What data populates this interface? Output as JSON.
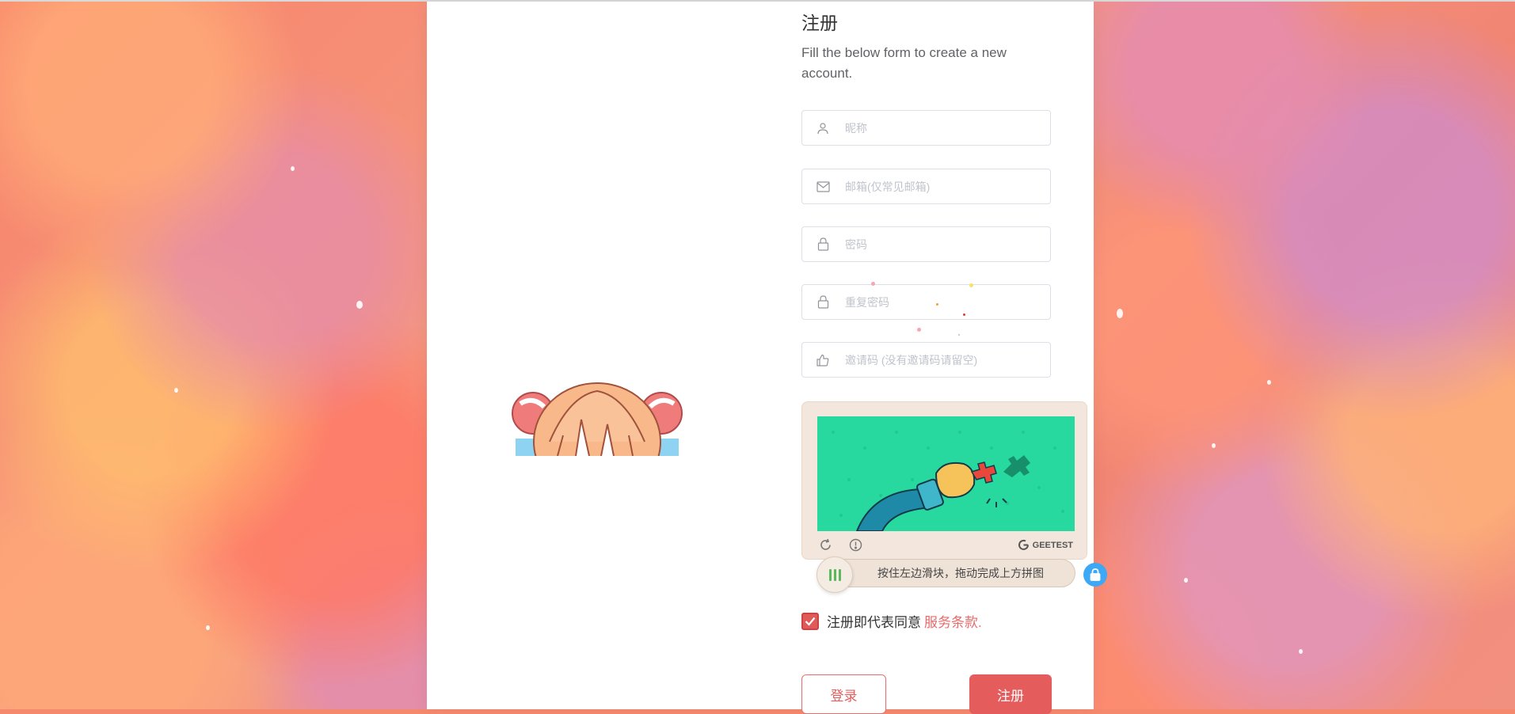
{
  "page": {
    "title": "注册",
    "subtitle": "Fill the below form to create a new account."
  },
  "form": {
    "fields": [
      {
        "placeholder": "昵称",
        "value": "",
        "icon": "user-icon"
      },
      {
        "placeholder": "邮箱(仅常见邮箱)",
        "value": "",
        "icon": "mail-icon"
      },
      {
        "placeholder": "密码",
        "value": "",
        "icon": "lock-icon"
      },
      {
        "placeholder": "重复密码",
        "value": "",
        "icon": "lock-icon"
      },
      {
        "placeholder": "邀请码 (没有邀请码请留空)",
        "value": "",
        "icon": "thumbs-up-icon"
      }
    ]
  },
  "captcha": {
    "brand": "GEETEST",
    "slider_hint": "按住左边滑块，拖动完成上方拼图",
    "refresh_icon": "refresh-icon",
    "info_icon": "info-icon",
    "lock_icon": "lock-icon"
  },
  "agreement": {
    "checked": true,
    "text": "注册即代表同意",
    "link": "服务条款."
  },
  "buttons": {
    "login": "登录",
    "register": "注册"
  },
  "colors": {
    "accent": "#e45c5c",
    "link": "#e96a6a",
    "captcha_bg": "#27d89f",
    "lock_badge": "#3da8f5"
  }
}
